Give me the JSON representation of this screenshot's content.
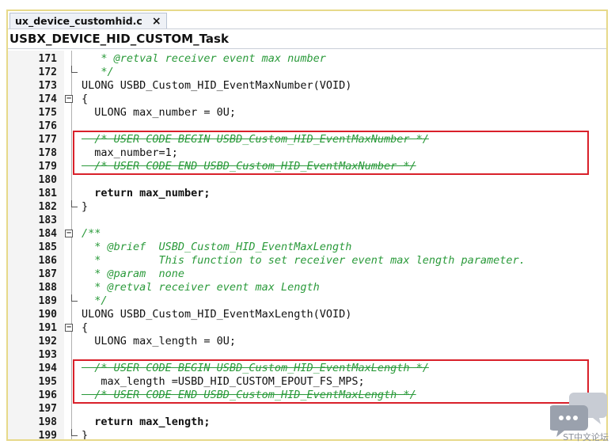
{
  "tab": {
    "label": "ux_device_customhid.c",
    "close_label": "×"
  },
  "function_bar": {
    "label": "USBX_DEVICE_HID_CUSTOM_Task"
  },
  "lines": [
    {
      "num": "171",
      "type": "comment",
      "text": "   * @retval receiver event max number",
      "fold": ""
    },
    {
      "num": "172",
      "type": "comment",
      "text": "   */",
      "fold": "end"
    },
    {
      "num": "173",
      "type": "plain",
      "text": "ULONG USBD_Custom_HID_EventMaxNumber(VOID)",
      "fold": ""
    },
    {
      "num": "174",
      "type": "plain",
      "text": "{",
      "fold": "open"
    },
    {
      "num": "175",
      "type": "plain",
      "text": "  ULONG max_number = 0U;",
      "fold": ""
    },
    {
      "num": "176",
      "type": "plain",
      "text": "",
      "fold": ""
    },
    {
      "num": "177",
      "type": "strike",
      "text": "  /* USER CODE BEGIN USBD_Custom_HID_EventMaxNumber */",
      "fold": ""
    },
    {
      "num": "178",
      "type": "plain",
      "text": "  max_number=1;",
      "fold": ""
    },
    {
      "num": "179",
      "type": "strike",
      "text": "  /* USER CODE END USBD_Custom_HID_EventMaxNumber */",
      "fold": ""
    },
    {
      "num": "180",
      "type": "plain",
      "text": "",
      "fold": ""
    },
    {
      "num": "181",
      "type": "kw",
      "text": "  return max_number;",
      "fold": ""
    },
    {
      "num": "182",
      "type": "plain",
      "text": "}",
      "fold": "end"
    },
    {
      "num": "183",
      "type": "plain",
      "text": "",
      "fold": ""
    },
    {
      "num": "184",
      "type": "comment",
      "text": "/**",
      "fold": "open"
    },
    {
      "num": "185",
      "type": "comment",
      "text": "  * @brief  USBD_Custom_HID_EventMaxLength",
      "fold": ""
    },
    {
      "num": "186",
      "type": "comment",
      "text": "  *         This function to set receiver event max length parameter.",
      "fold": ""
    },
    {
      "num": "187",
      "type": "comment",
      "text": "  * @param  none",
      "fold": ""
    },
    {
      "num": "188",
      "type": "comment",
      "text": "  * @retval receiver event max Length",
      "fold": ""
    },
    {
      "num": "189",
      "type": "comment",
      "text": "  */",
      "fold": "end"
    },
    {
      "num": "190",
      "type": "plain",
      "text": "ULONG USBD_Custom_HID_EventMaxLength(VOID)",
      "fold": ""
    },
    {
      "num": "191",
      "type": "plain",
      "text": "{",
      "fold": "open"
    },
    {
      "num": "192",
      "type": "plain",
      "text": "  ULONG max_length = 0U;",
      "fold": ""
    },
    {
      "num": "193",
      "type": "plain",
      "text": "",
      "fold": ""
    },
    {
      "num": "194",
      "type": "strike",
      "text": "  /* USER CODE BEGIN USBD_Custom_HID_EventMaxLength */",
      "fold": ""
    },
    {
      "num": "195",
      "type": "plain",
      "text": "   max_length =USBD_HID_CUSTOM_EPOUT_FS_MPS;",
      "fold": ""
    },
    {
      "num": "196",
      "type": "strike",
      "text": "  /* USER CODE END USBD_Custom_HID_EventMaxLength */",
      "fold": ""
    },
    {
      "num": "197",
      "type": "plain",
      "text": "",
      "fold": ""
    },
    {
      "num": "198",
      "type": "kw",
      "text": "  return max_length;",
      "fold": ""
    },
    {
      "num": "199",
      "type": "plain",
      "text": "}",
      "fold": "end"
    }
  ],
  "highlight_boxes": [
    {
      "label": "lines 178-179"
    },
    {
      "label": "lines 194-196"
    }
  ],
  "watermark": {
    "text": "ST中文论坛"
  },
  "colors": {
    "comment": "#2a9a3a",
    "highlight": "#d9202a",
    "frame": "#e7d98a"
  }
}
